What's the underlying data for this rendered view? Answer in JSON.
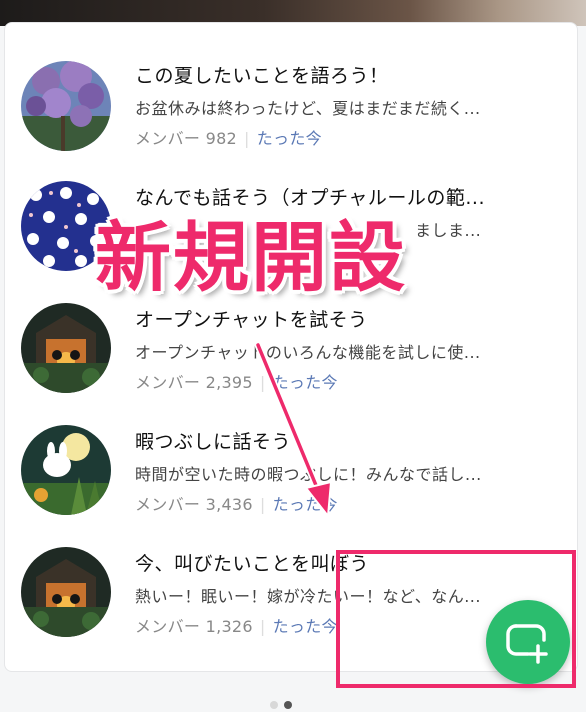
{
  "rooms": [
    {
      "title": "この夏したいことを語ろう！",
      "desc": "お盆休みは終わったけど、夏はまだまだ続く...",
      "members_label": "メンバー 982",
      "time": "たった今",
      "avatar": "wisteria-icon"
    },
    {
      "title": "なんでも話そう（オプチャルールの範...",
      "desc": "ましま...",
      "members_label": "",
      "time": "",
      "avatar": "bunny-pattern-icon"
    },
    {
      "title": "オープンチャットを試そう",
      "desc": "オープンチャットのいろんな機能を試しに使...",
      "members_label": "メンバー 2,395",
      "time": "たった今",
      "avatar": "night-campfire-icon"
    },
    {
      "title": "暇つぶしに話そう",
      "desc": "時間が空いた時の暇つぶしに！みんなで話し...",
      "members_label": "メンバー 3,436",
      "time": "たった今",
      "avatar": "moon-bunny-icon"
    },
    {
      "title": "今、叫びたいことを叫ぼう",
      "desc": "熱いー！眠いー！嫁が冷たいー！など、なん...",
      "members_label": "メンバー 1,326",
      "time": "たった今",
      "avatar": "night-campfire-icon"
    }
  ],
  "annotation": {
    "label": "新規開設",
    "color": "#ee2a6b"
  },
  "fab": {
    "icon": "new-chat-plus-icon",
    "color": "#2bbd6e"
  },
  "pagination": {
    "total": 2,
    "active": 2
  }
}
